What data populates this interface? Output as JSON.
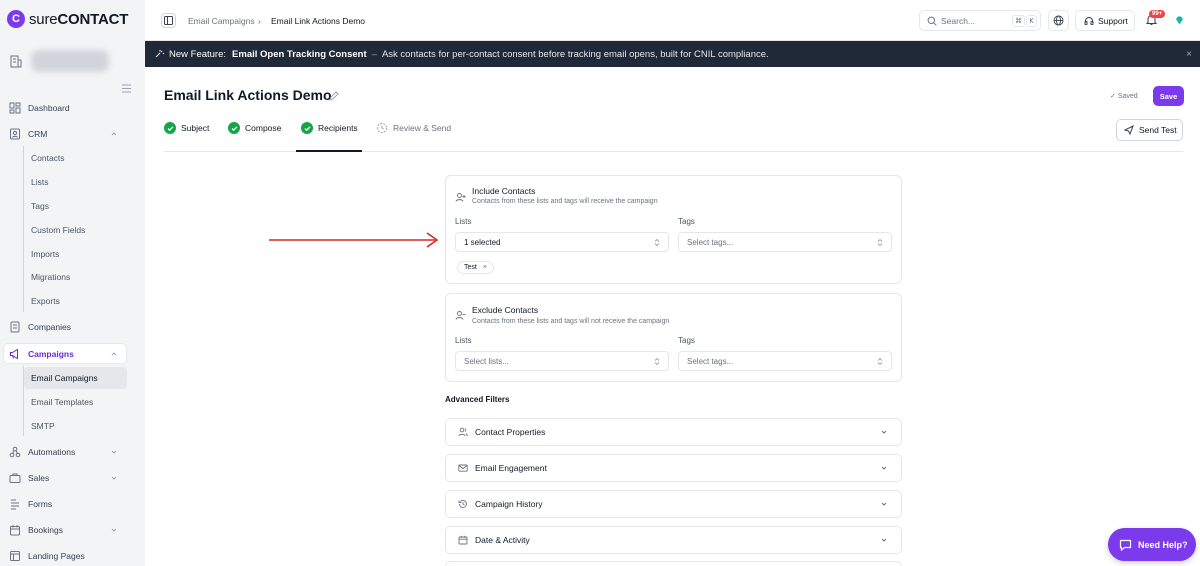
{
  "brand": {
    "sure": "sure",
    "contact": "CONTACT"
  },
  "sidebar": {
    "items": [
      {
        "label": "Dashboard",
        "icon": "dashboard-icon"
      },
      {
        "label": "CRM",
        "icon": "crm-icon"
      },
      {
        "label": "Companies",
        "icon": "building-icon"
      },
      {
        "label": "Campaigns",
        "icon": "megaphone-icon"
      },
      {
        "label": "Automations",
        "icon": "automation-icon"
      },
      {
        "label": "Sales",
        "icon": "briefcase-icon"
      },
      {
        "label": "Forms",
        "icon": "form-icon"
      },
      {
        "label": "Bookings",
        "icon": "calendar-icon"
      },
      {
        "label": "Landing Pages",
        "icon": "page-icon"
      }
    ],
    "crm_sub": [
      "Contacts",
      "Lists",
      "Tags",
      "Custom Fields",
      "Imports",
      "Migrations",
      "Exports"
    ],
    "campaigns_sub": [
      "Email Campaigns",
      "Email Templates",
      "SMTP"
    ]
  },
  "topbar": {
    "breadcrumb": [
      "Email Campaigns",
      "Email Link Actions Demo"
    ],
    "search_placeholder": "Search...",
    "kbd_cmd": "⌘",
    "kbd_k": "K",
    "support_label": "Support",
    "notification_count": "99+"
  },
  "banner": {
    "tag": "New Feature:",
    "title": "Email Open Tracking Consent",
    "separator": "–",
    "text": "Ask contacts for per-contact consent before tracking email opens, built for CNIL compliance.",
    "close": "×"
  },
  "page": {
    "title": "Email Link Actions Demo",
    "saved_label": "Saved",
    "save_label": "Save",
    "send_test_label": "Send Test"
  },
  "steps": [
    {
      "label": "Subject",
      "done": true
    },
    {
      "label": "Compose",
      "done": true
    },
    {
      "label": "Recipients",
      "done": true
    },
    {
      "label": "Review & Send",
      "done": false
    }
  ],
  "include": {
    "title": "Include Contacts",
    "desc": "Contacts from these lists and tags will receive the campaign",
    "lists_label": "Lists",
    "lists_value": "1 selected",
    "tags_label": "Tags",
    "tags_placeholder": "Select tags...",
    "chip": "Test",
    "chip_remove": "×"
  },
  "exclude": {
    "title": "Exclude Contacts",
    "desc": "Contacts from these lists and tags will not receive the campaign",
    "lists_label": "Lists",
    "lists_placeholder": "Select lists...",
    "tags_label": "Tags",
    "tags_placeholder": "Select tags..."
  },
  "advanced": {
    "title": "Advanced Filters",
    "items": [
      {
        "label": "Contact Properties",
        "icon": "users-icon"
      },
      {
        "label": "Email Engagement",
        "icon": "mail-icon"
      },
      {
        "label": "Campaign History",
        "icon": "history-icon"
      },
      {
        "label": "Date & Activity",
        "icon": "calendar-icon"
      }
    ]
  },
  "help": {
    "label": "Need Help?"
  },
  "colors": {
    "accent": "#7c3aed",
    "success": "#16a34a",
    "banner_bg": "#1f2937",
    "annotation_arrow": "#dc2626"
  }
}
